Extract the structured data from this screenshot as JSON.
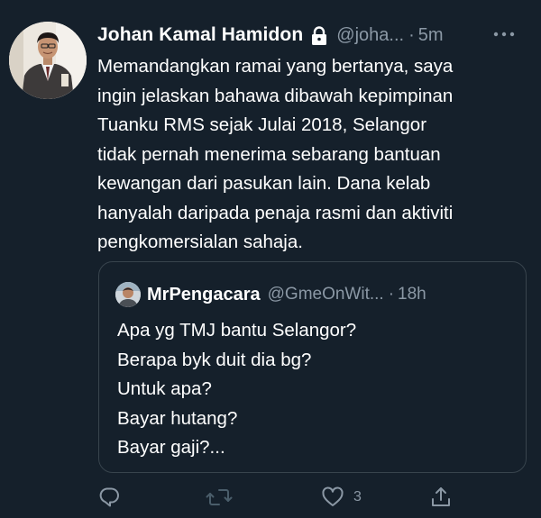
{
  "tweet": {
    "author": {
      "display_name": "Johan Kamal Hamidon",
      "handle": "@joha...",
      "protected_icon": "lock-icon"
    },
    "separator": "·",
    "time": "5m",
    "more_icon": "more-horizontal-icon",
    "text_lines": [
      "Memandangkan ramai yang bertanya, saya",
      "ingin jelaskan bahawa dibawah kepimpinan",
      "Tuanku RMS sejak Julai 2018, Selangor",
      "tidak pernah menerima sebarang bantuan",
      "kewangan dari pasukan lain. Dana kelab",
      "hanyalah daripada penaja rasmi dan aktiviti",
      "pengkomersialan sahaja."
    ]
  },
  "quote": {
    "author": {
      "display_name": "MrPengacara",
      "handle": "@GmeOnWit..."
    },
    "separator": "·",
    "time": "18h",
    "text_lines": [
      "Apa yg TMJ bantu Selangor?",
      "Berapa byk duit dia bg?",
      "Untuk apa?",
      "Bayar hutang?",
      "Bayar gaji?..."
    ]
  },
  "actions": {
    "reply": {
      "icon": "reply-icon",
      "count": ""
    },
    "retweet": {
      "icon": "retweet-icon",
      "count": ""
    },
    "like": {
      "icon": "heart-icon",
      "count": "3"
    },
    "share": {
      "icon": "share-icon",
      "count": ""
    }
  },
  "colors": {
    "background": "#15202b",
    "primary_text": "#ffffff",
    "secondary_text": "#8b98a5",
    "border": "#38444d",
    "retweet_icon": "#4a5d6a"
  }
}
